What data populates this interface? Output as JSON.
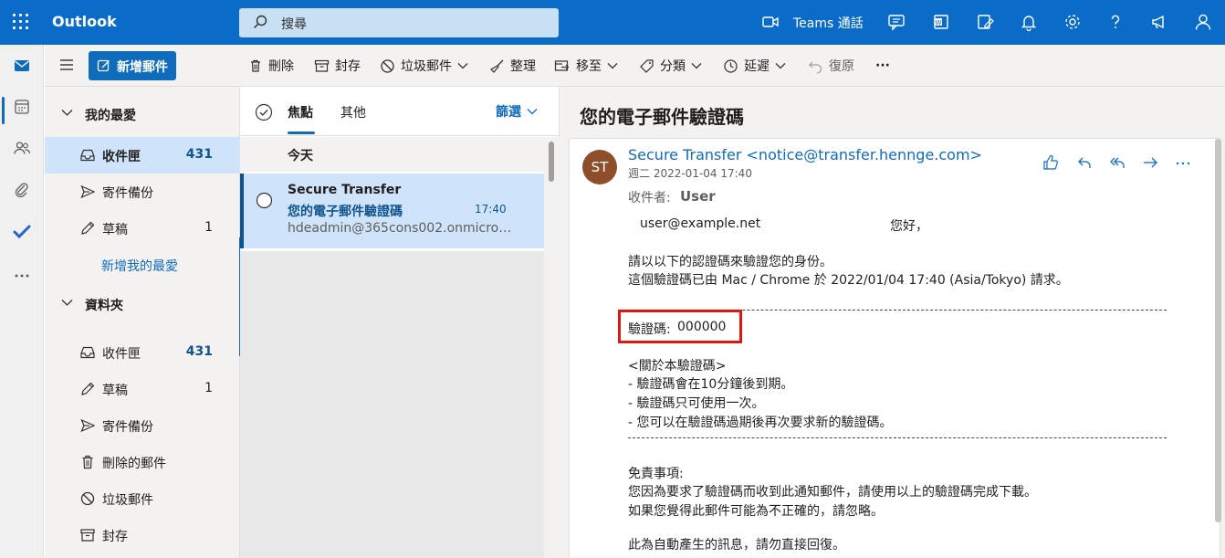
{
  "app": {
    "brand": "Outlook",
    "search_placeholder": "搜尋",
    "teams_label": "Teams 通話"
  },
  "toolbar": {
    "new_mail": "新增郵件",
    "delete": "刪除",
    "archive": "封存",
    "junk": "垃圾郵件",
    "sweep": "整理",
    "move": "移至",
    "categorize": "分類",
    "snooze": "延遲",
    "undo": "復原",
    "more": "···"
  },
  "favorites": {
    "header": "我的最愛",
    "items": [
      {
        "label": "收件匣",
        "count": "431",
        "icon": "inbox-icon",
        "selected": true
      },
      {
        "label": "寄件備份",
        "count": "",
        "icon": "send-icon"
      },
      {
        "label": "草稿",
        "count": "1",
        "icon": "pencil-icon"
      }
    ],
    "add_link": "新增我的最愛"
  },
  "folders": {
    "header": "資料夾",
    "items": [
      {
        "label": "收件匣",
        "count": "431",
        "icon": "inbox-icon"
      },
      {
        "label": "草稿",
        "count": "1",
        "icon": "pencil-icon"
      },
      {
        "label": "寄件備份",
        "count": "",
        "icon": "send-icon"
      },
      {
        "label": "刪除的郵件",
        "count": "",
        "icon": "trash-icon"
      },
      {
        "label": "垃圾郵件",
        "count": "",
        "icon": "blocked-icon"
      },
      {
        "label": "封存",
        "count": "",
        "icon": "archive-icon"
      }
    ]
  },
  "message_list": {
    "tab_focused": "焦點",
    "tab_other": "其他",
    "filter": "篩選",
    "group_today": "今天",
    "message": {
      "from": "Secure Transfer",
      "subject": "您的電子郵件驗證碼",
      "time": "17:40",
      "preview": "hdeadmin@365cons002.onmicros..."
    }
  },
  "reading": {
    "subject": "您的電子郵件驗證碼",
    "avatar_initials": "ST",
    "avatar_color": "#8f4e2a",
    "sender": "Secure Transfer <notice@transfer.hennge.com>",
    "date": "週二 2022-01-04 17:40",
    "recipient_label": "收件者:",
    "recipient_name": "User",
    "greeting_email": "user@example.net",
    "greeting": "您好，",
    "line1": "請以以下的認證碼來驗證您的身份。",
    "line2": "這個驗證碼已由 Mac / Chrome 於 2022/01/04 17:40 (Asia/Tokyo) 請求。",
    "code_label": "驗證碼:",
    "code_value": "000000",
    "about_header": "<關於本驗證碼>",
    "about1": "- 驗證碼會在10分鐘後到期。",
    "about2": "- 驗證碼只可使用一次。",
    "about3": "- 您可以在驗證碼過期後再次要求新的驗證碼。",
    "disclaimer_header": "免責事項:",
    "disclaimer1": "您因為要求了驗證碼而收到此通知郵件，請使用以上的驗證碼完成下載。",
    "disclaimer2": "如果您覺得此郵件可能為不正確的，請忽略。",
    "footer": "此為自動產生的訊息，請勿直接回復。"
  },
  "colors": {
    "brand_blue": "#0a6bc9",
    "selection": "#cfe4fa",
    "highlight_box": "#e3160b"
  }
}
